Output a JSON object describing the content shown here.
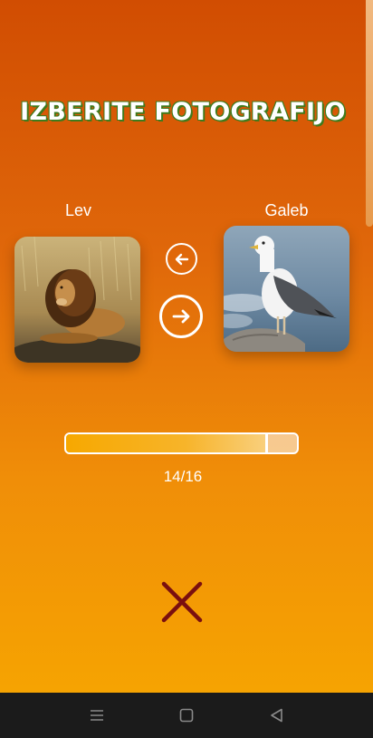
{
  "header": {
    "title": "IZBERITE FOTOGRAFIJO"
  },
  "left_option": {
    "label": "Lev",
    "image": "lion-photo"
  },
  "right_option": {
    "label": "Galeb",
    "image": "seagull-photo"
  },
  "controls": {
    "back_icon": "arrow-left-circle-icon",
    "next_icon": "arrow-right-circle-icon",
    "close_icon": "close-x-icon"
  },
  "progress": {
    "current": 14,
    "total": 16,
    "text": "14/16",
    "fraction": 0.875
  },
  "colors": {
    "bg_top": "#d14d02",
    "bg_bottom": "#f7a800",
    "title_outline": "#3f7a1c",
    "close_x": "#7a0f0f",
    "navbar": "#1b1b1b"
  },
  "navbar": {
    "menu_icon": "menu-icon",
    "home_icon": "square-home-icon",
    "back_icon": "triangle-back-icon"
  }
}
